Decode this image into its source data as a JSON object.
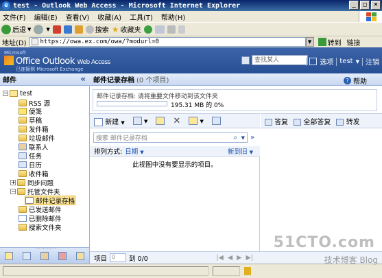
{
  "window": {
    "title": "test - Outlook Web Access - Microsoft Internet Explorer"
  },
  "menu": [
    "文件(F)",
    "编辑(E)",
    "查看(V)",
    "收藏(A)",
    "工具(T)",
    "帮助(H)"
  ],
  "toolbar": {
    "back": "后退",
    "search": "搜索",
    "favorites": "收藏夹"
  },
  "address": {
    "label": "地址(D)",
    "url": "https://owa.ex.com/owa/?modurl=0",
    "go": "转到",
    "links": "链接"
  },
  "owa": {
    "brand_ms": "Microsoft",
    "brand_name": "Office Outlook",
    "brand_suffix": "Web Access",
    "brand_sub": "已连接到 Microsoft Exchange",
    "find_placeholder": "查找某人",
    "options": "选项",
    "user": "test",
    "logoff": "注销"
  },
  "nav": {
    "title": "邮件",
    "root": "test",
    "folders": [
      "RSS 源",
      "便笺",
      "草稿",
      "发件箱",
      "垃圾邮件",
      "联系人",
      "任务",
      "日历",
      "收件箱",
      "同步问题",
      "托管文件夹",
      "邮件记录存档",
      "已发送邮件",
      "已删除邮件",
      "搜索文件夹"
    ],
    "grip": "……….."
  },
  "content": {
    "title": "邮件记录存档",
    "count": "(0 个项目)",
    "help": "帮助",
    "quota_text": "邮件记录存档: 请将重要文件移动到该文件夹",
    "quota_usage": "195.31 MB 的 0%",
    "quota_fraction": 0,
    "new": "新建",
    "reply": "答复",
    "reply_all": "全部答复",
    "forward": "转发",
    "search_placeholder": "搜索 邮件记录存档",
    "sort_label": "排列方式:",
    "sort_field": "日期",
    "sort_order": "新到旧",
    "empty": "此视图中没有要显示的项目。",
    "pager_label": "项目",
    "pager_value": "0",
    "pager_range": "到 0/0"
  },
  "watermark": {
    "site": "51CTO.com",
    "blog": "技术博客 Blog"
  }
}
